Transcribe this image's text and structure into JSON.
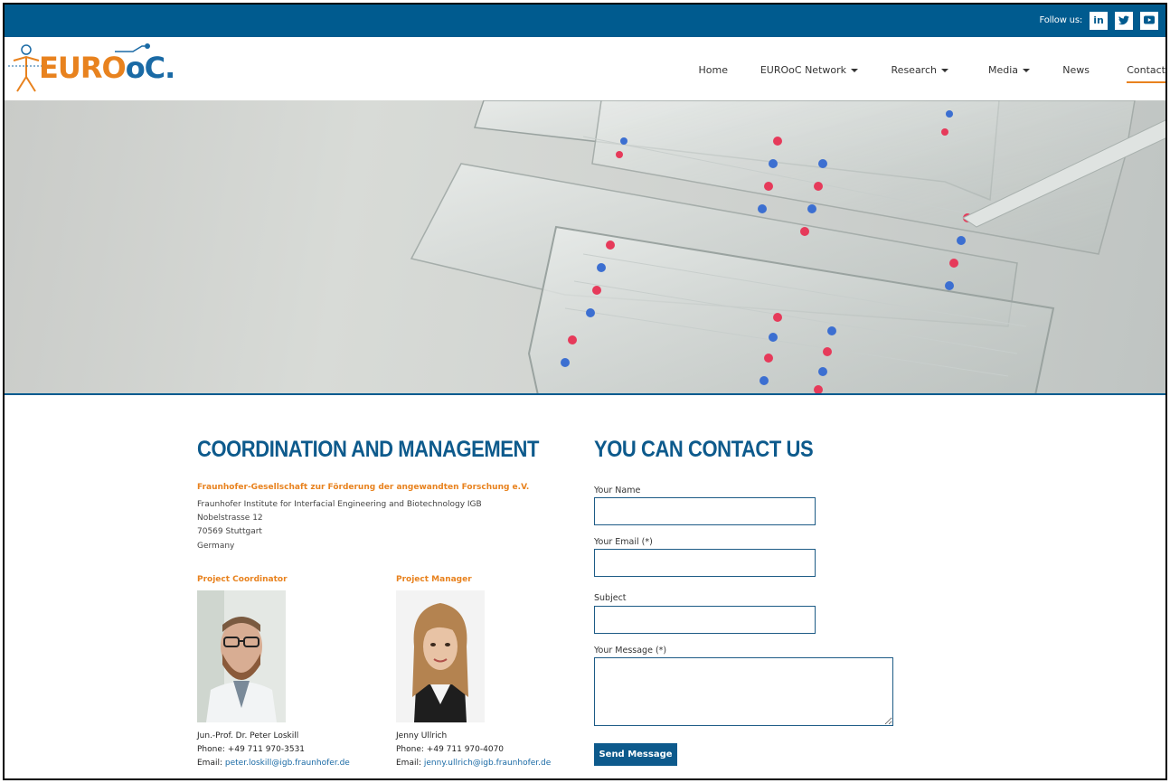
{
  "topbar": {
    "follow_label": "Follow us:",
    "social": [
      {
        "name": "linkedin-icon",
        "label": "in"
      },
      {
        "name": "twitter-icon",
        "label": ""
      },
      {
        "name": "youtube-icon",
        "label": ""
      }
    ]
  },
  "logo": {
    "part1": "EURO",
    "part2": "oC",
    "part3": "."
  },
  "nav": {
    "items": [
      {
        "label": "Home",
        "dropdown": false
      },
      {
        "label": "EUROoC Network",
        "dropdown": true
      },
      {
        "label": "Research",
        "dropdown": true
      },
      {
        "label": "Media",
        "dropdown": true
      },
      {
        "label": "News",
        "dropdown": false
      },
      {
        "label": "Contact",
        "dropdown": false,
        "active": true
      }
    ]
  },
  "coordination": {
    "title": "COORDINATION AND MANAGEMENT",
    "org": "Fraunhofer-Gesellschaft zur Förderung der angewandten Forschung e.V.",
    "address": [
      "Fraunhofer Institute for Interfacial Engineering and Biotechnology IGB",
      "Nobelstrasse 12",
      "70569 Stuttgart",
      "Germany"
    ],
    "people": [
      {
        "role": "Project Coordinator",
        "name": "Jun.-Prof. Dr. Peter Loskill",
        "phone_label": "Phone:",
        "phone": "+49 711 970-3531",
        "email_label": "Email:",
        "email": "peter.loskill@igb.fraunhofer.de"
      },
      {
        "role": "Project Manager",
        "name": "Jenny Ullrich",
        "phone_label": "Phone:",
        "phone": "+49 711 970-4070",
        "email_label": "Email:",
        "email": "jenny.ullrich@igb.fraunhofer.de"
      }
    ]
  },
  "contact_form": {
    "title": "YOU CAN CONTACT US",
    "name_label": "Your Name",
    "name_value": "",
    "email_label": "Your Email (*)",
    "email_value": "",
    "subject_label": "Subject",
    "subject_value": "",
    "message_label": "Your Message (*)",
    "message_value": "",
    "send_label": "Send Message"
  },
  "colors": {
    "brand_blue": "#005b8f",
    "accent_orange": "#e8821e",
    "heading_blue": "#0d5a8c"
  }
}
